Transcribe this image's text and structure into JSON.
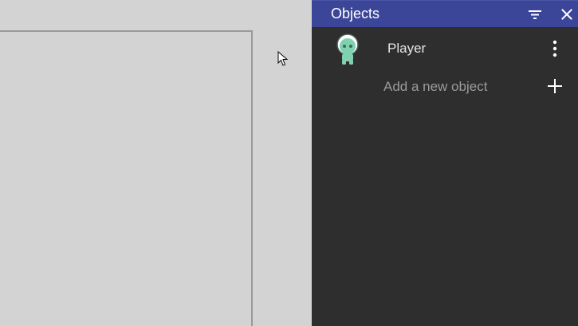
{
  "panel": {
    "title": "Objects",
    "filter_icon": "filter-icon",
    "close_icon": "close-icon"
  },
  "objects": [
    {
      "label": "Player",
      "icon": "player-alien-icon",
      "menu_icon": "more-vert-icon"
    }
  ],
  "add_object": {
    "label": "Add a new object",
    "icon": "plus-icon"
  },
  "colors": {
    "header_bg": "#3b4699",
    "panel_bg": "#2e2e2e",
    "canvas_bg": "#d3d3d3",
    "scene_border": "#9a9a9a",
    "player_green": "#7fd1b0"
  }
}
